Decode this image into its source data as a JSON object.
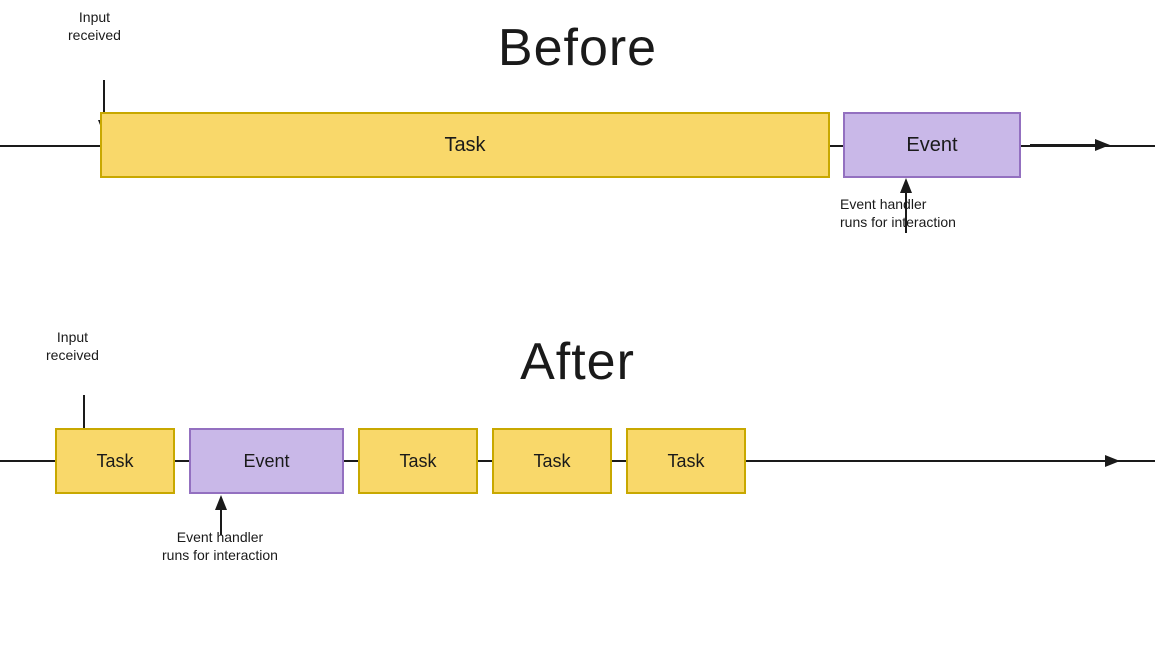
{
  "before": {
    "title": "Before",
    "input_label": "Input\nreceived",
    "task_label": "Task",
    "event_label": "Event",
    "event_handler_label": "Event handler\nruns for interaction"
  },
  "after": {
    "title": "After",
    "input_label": "Input\nreceived",
    "task_label": "Task",
    "event_label": "Event",
    "event_handler_label": "Event handler\nruns for interaction",
    "tasks": [
      "Task",
      "Task",
      "Task",
      "Task"
    ],
    "event": "Event"
  },
  "colors": {
    "task_bg": "#f9d86a",
    "task_border": "#c8a800",
    "event_bg": "#c9b8e8",
    "event_border": "#9370c0",
    "text": "#1a1a1a",
    "line": "#1a1a1a"
  }
}
